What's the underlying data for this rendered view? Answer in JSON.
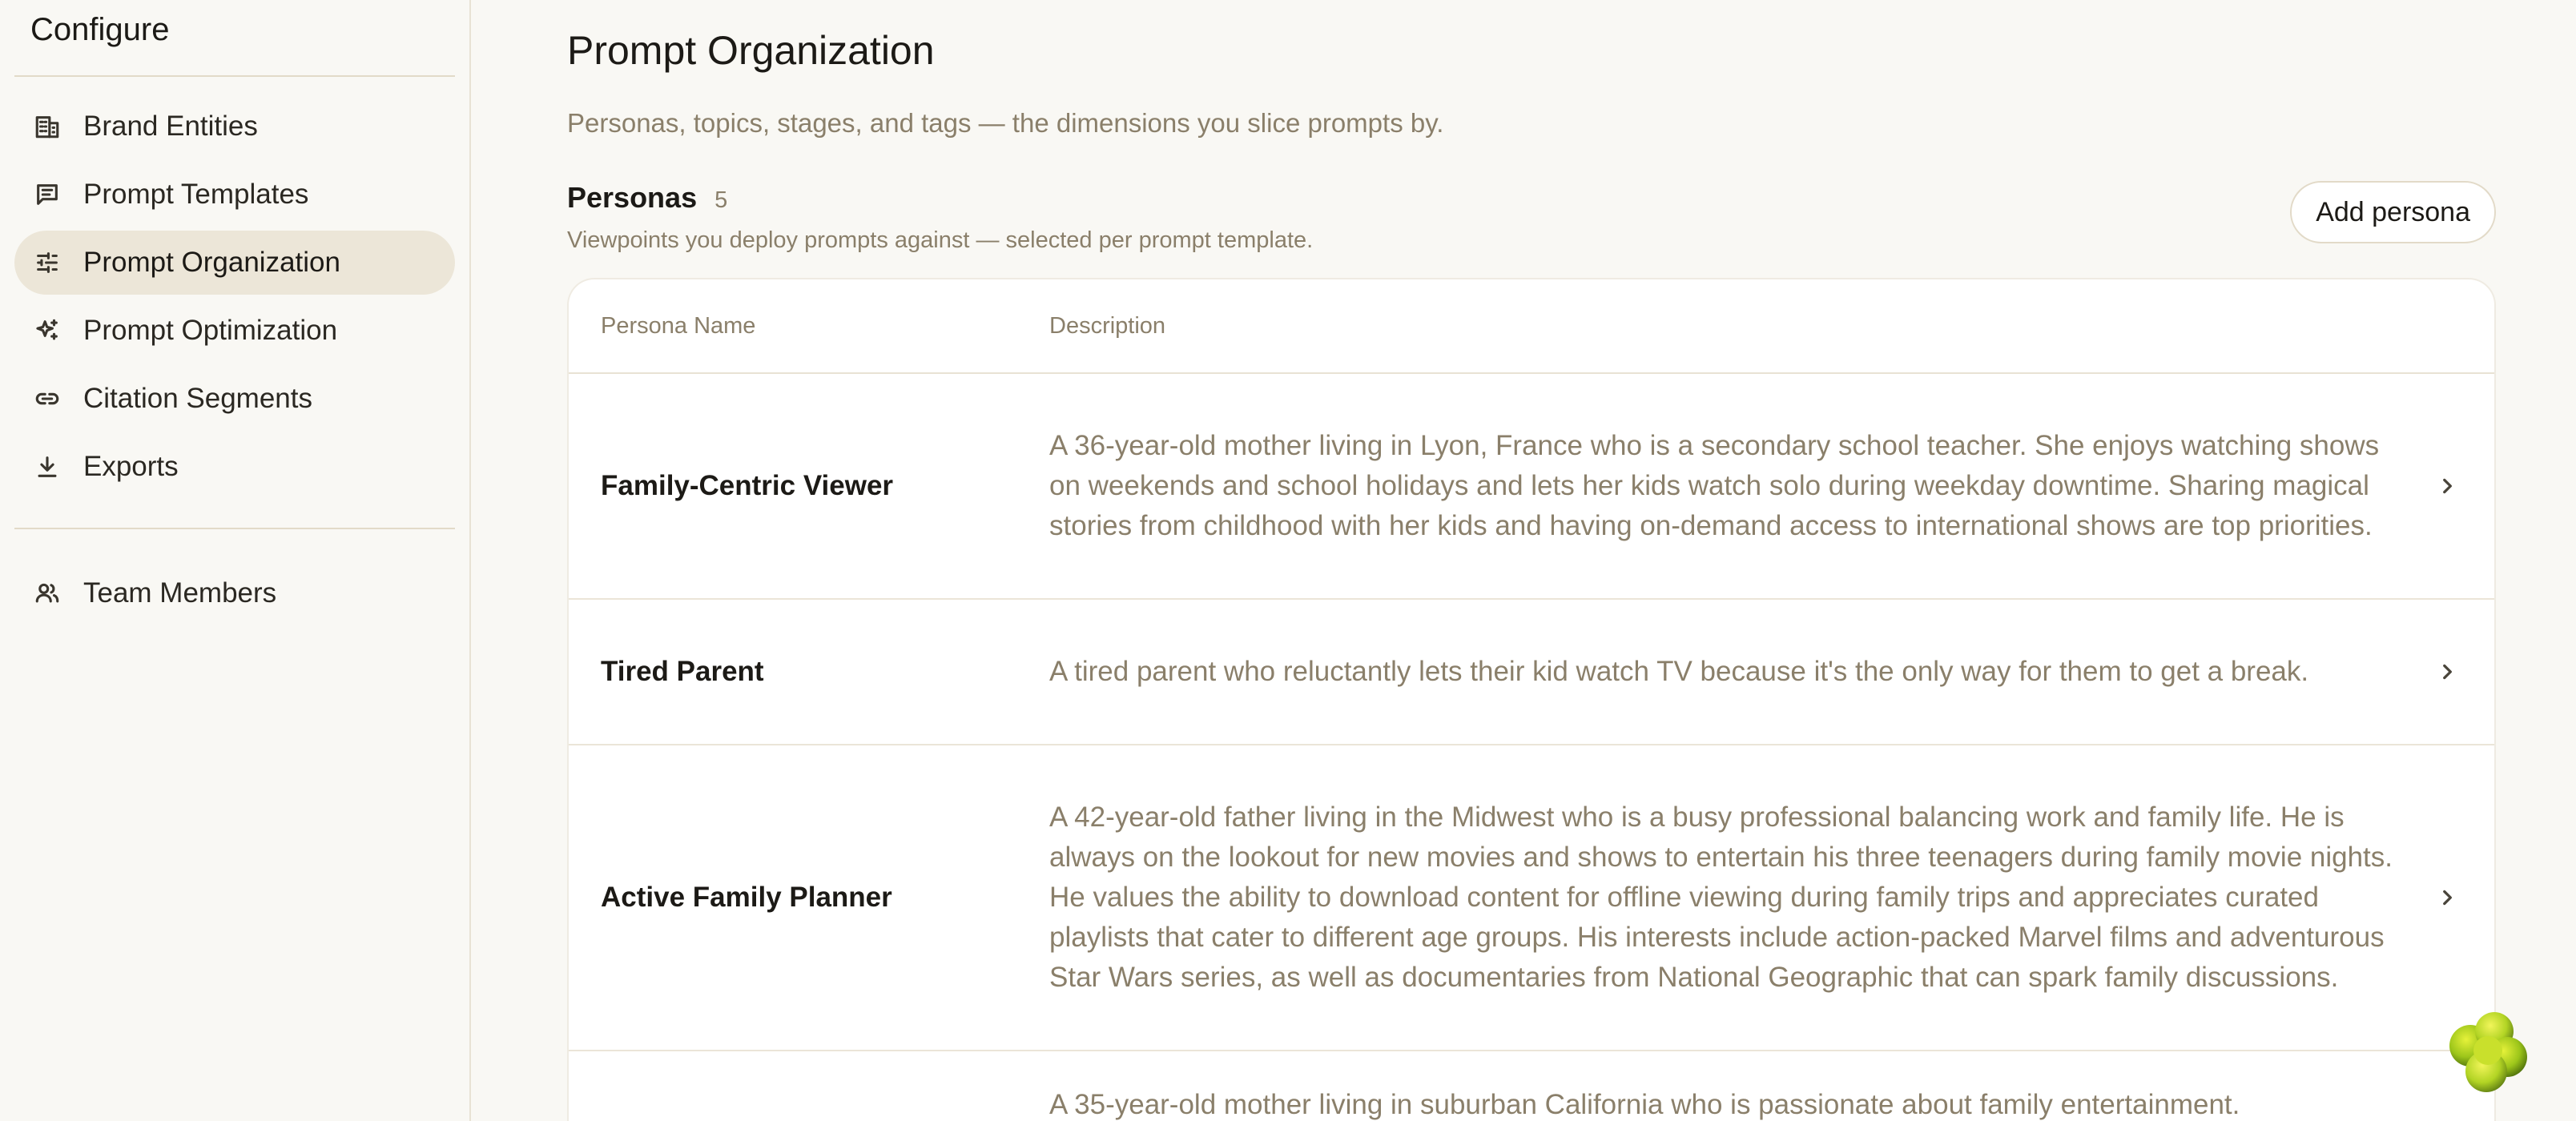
{
  "sidebar": {
    "title": "Configure",
    "items": [
      {
        "label": "Brand Entities",
        "icon": "building-icon"
      },
      {
        "label": "Prompt Templates",
        "icon": "message-square-icon"
      },
      {
        "label": "Prompt Organization",
        "icon": "sliders-icon",
        "active": true
      },
      {
        "label": "Prompt Optimization",
        "icon": "sparkles-icon"
      },
      {
        "label": "Citation Segments",
        "icon": "link-icon"
      },
      {
        "label": "Exports",
        "icon": "download-icon"
      }
    ],
    "footer_items": [
      {
        "label": "Team Members",
        "icon": "users-icon"
      }
    ]
  },
  "page": {
    "title": "Prompt Organization",
    "subtitle": "Personas, topics, stages, and tags — the dimensions you slice prompts by."
  },
  "personas": {
    "title": "Personas",
    "count": "5",
    "description": "Viewpoints you deploy prompts against — selected per prompt template.",
    "add_label": "Add persona",
    "columns": {
      "name": "Persona Name",
      "description": "Description"
    },
    "rows": [
      {
        "name": "Family-Centric Viewer",
        "description": "A 36-year-old mother living in Lyon, France who is a secondary school teacher. She enjoys watching shows on weekends and school holidays and lets her kids watch solo during weekday downtime. Sharing magical stories from childhood with her kids and having on-demand access to international shows are top priorities."
      },
      {
        "name": "Tired Parent",
        "description": "A tired parent who reluctantly lets their kid watch TV because it's the only way for them to get a break."
      },
      {
        "name": "Active Family Planner",
        "description": "A 42-year-old father living in the Midwest who is a busy professional balancing work and family life. He is always on the lookout for new movies and shows to entertain his three teenagers during family movie nights. He values the ability to download content for offline viewing during family trips and appreciates curated playlists that cater to different age groups. His interests include action-packed Marvel films and adventurous Star Wars series, as well as documentaries from National Geographic that can spark family discussions."
      },
      {
        "name": "",
        "description": "A 35-year-old mother living in suburban California who is passionate about family entertainment."
      }
    ]
  },
  "colors": {
    "background": "#f9f8f4",
    "sidebar_active": "#ece6d8",
    "muted_text": "#8a7f6a",
    "border": "#e8e2d4"
  }
}
